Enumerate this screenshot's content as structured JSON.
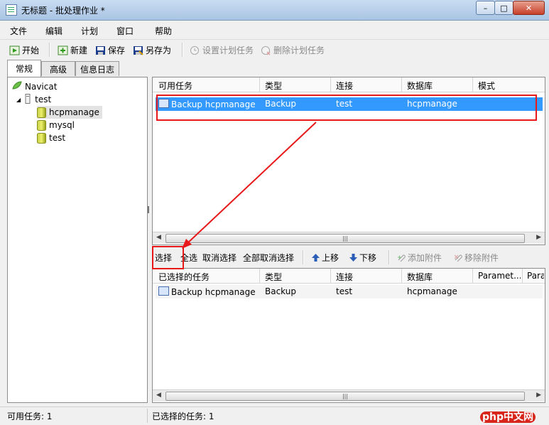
{
  "window": {
    "title": "无标题 - 批处理作业 *",
    "min": "–",
    "max": "□",
    "close": "✕"
  },
  "menu": [
    "文件",
    "编辑",
    "计划",
    "窗口",
    "帮助"
  ],
  "toolbar": {
    "start": "开始",
    "new": "新建",
    "save": "保存",
    "save_as": "另存为",
    "set_schedule": "设置计划任务",
    "delete_schedule": "删除计划任务"
  },
  "tabs": [
    "常规",
    "高级",
    "信息日志"
  ],
  "tree": {
    "root": "Navicat",
    "connection": "test",
    "databases": [
      "hcpmanage",
      "mysql",
      "test"
    ]
  },
  "available": {
    "columns": [
      "可用任务",
      "类型",
      "连接",
      "数据库",
      "模式"
    ],
    "rows": [
      {
        "task": "Backup hcpmanage",
        "type": "Backup",
        "connection": "test",
        "database": "hcpmanage"
      }
    ]
  },
  "midbar": {
    "select": "选择",
    "select_all": "全选",
    "deselect": "取消选择",
    "deselect_all": "全部取消选择",
    "move_up": "上移",
    "move_down": "下移",
    "add_attachment": "添加附件",
    "remove_attachment": "移除附件"
  },
  "selected": {
    "columns": [
      "已选择的任务",
      "类型",
      "连接",
      "数据库",
      "Paramet...",
      "Para"
    ],
    "rows": [
      {
        "task": "Backup hcpmanage",
        "type": "Backup",
        "connection": "test",
        "database": "hcpmanage"
      }
    ]
  },
  "status": {
    "available": "可用任务: 1",
    "selected": "已选择的任务: 1"
  },
  "watermark": "php中文网",
  "colors": {
    "selection": "#3399ff",
    "annotation": "#e8191b"
  }
}
